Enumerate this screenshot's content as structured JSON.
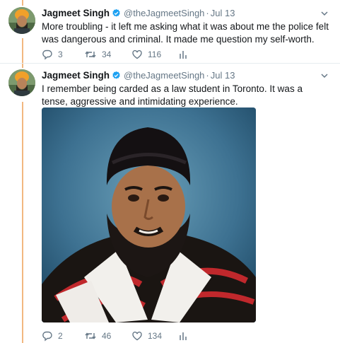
{
  "tweets": [
    {
      "author_name": "Jagmeet Singh",
      "handle": "@theJagmeetSingh",
      "separator": "·",
      "date": "Jul 13",
      "text": "More troubling - it left me asking what it was about me the police felt was dangerous and criminal. It made me question my self-worth.",
      "replies": "3",
      "retweets": "34",
      "likes": "116"
    },
    {
      "author_name": "Jagmeet Singh",
      "handle": "@theJagmeetSingh",
      "separator": "·",
      "date": "Jul 13",
      "text": "I remember being carded as a law student in Toronto. It was a tense, aggressive and intimidating experience.",
      "replies": "2",
      "retweets": "46",
      "likes": "134"
    }
  ],
  "colors": {
    "thread_line": "#f2b880",
    "verified": "#1da1f2",
    "muted": "#657786",
    "text": "#14171a"
  },
  "icons": [
    "verified-badge-icon",
    "chevron-down-icon",
    "reply-icon",
    "retweet-icon",
    "like-icon",
    "analytics-icon"
  ]
}
